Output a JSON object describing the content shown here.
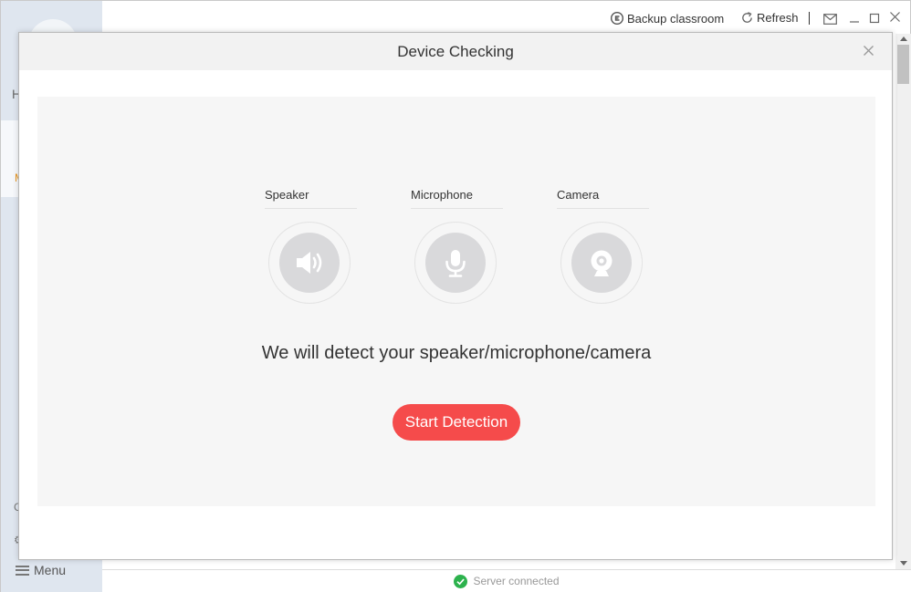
{
  "app": {
    "sidebar": {
      "nav_partial_1": "H",
      "nav_partial_2": "M",
      "icon_partial_1": "C",
      "icon_partial_2": "⚙",
      "menu_label": "Menu"
    },
    "topbar": {
      "backup_label": "Backup classroom",
      "refresh_label": "Refresh",
      "separator": "|"
    },
    "statusbar": {
      "status_text": "Server connected",
      "status_color": "#2db24d"
    }
  },
  "dialog": {
    "title": "Device Checking",
    "devices": [
      {
        "label": "Speaker",
        "icon": "speaker-icon"
      },
      {
        "label": "Microphone",
        "icon": "microphone-icon"
      },
      {
        "label": "Camera",
        "icon": "camera-icon"
      }
    ],
    "message": "We will detect your speaker/microphone/camera",
    "start_button": "Start Detection",
    "accent_color": "#f54b4b"
  }
}
